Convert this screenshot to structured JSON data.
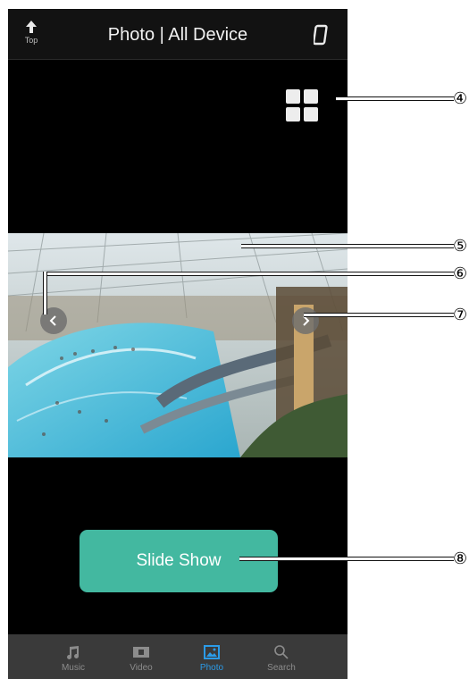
{
  "header": {
    "top_label": "Top",
    "title": "Photo | All Device",
    "top_icon": "up-arrow-icon",
    "device_icon": "phone-icon"
  },
  "grid_icon": "grid-view-icon",
  "photo": {
    "description_icon": "photo-image",
    "prev_icon": "chevron-left-icon",
    "next_icon": "chevron-right-icon"
  },
  "slideshow": {
    "label": "Slide Show",
    "color": "#43b8a0"
  },
  "tabs": [
    {
      "label": "Music",
      "icon": "music-note-icon",
      "active": false
    },
    {
      "label": "Video",
      "icon": "video-icon",
      "active": false
    },
    {
      "label": "Photo",
      "icon": "photo-icon",
      "active": true
    },
    {
      "label": "Search",
      "icon": "search-icon",
      "active": false
    }
  ],
  "active_color": "#2b9be8",
  "callouts": [
    "④",
    "⑤",
    "⑥",
    "⑦",
    "⑧"
  ]
}
